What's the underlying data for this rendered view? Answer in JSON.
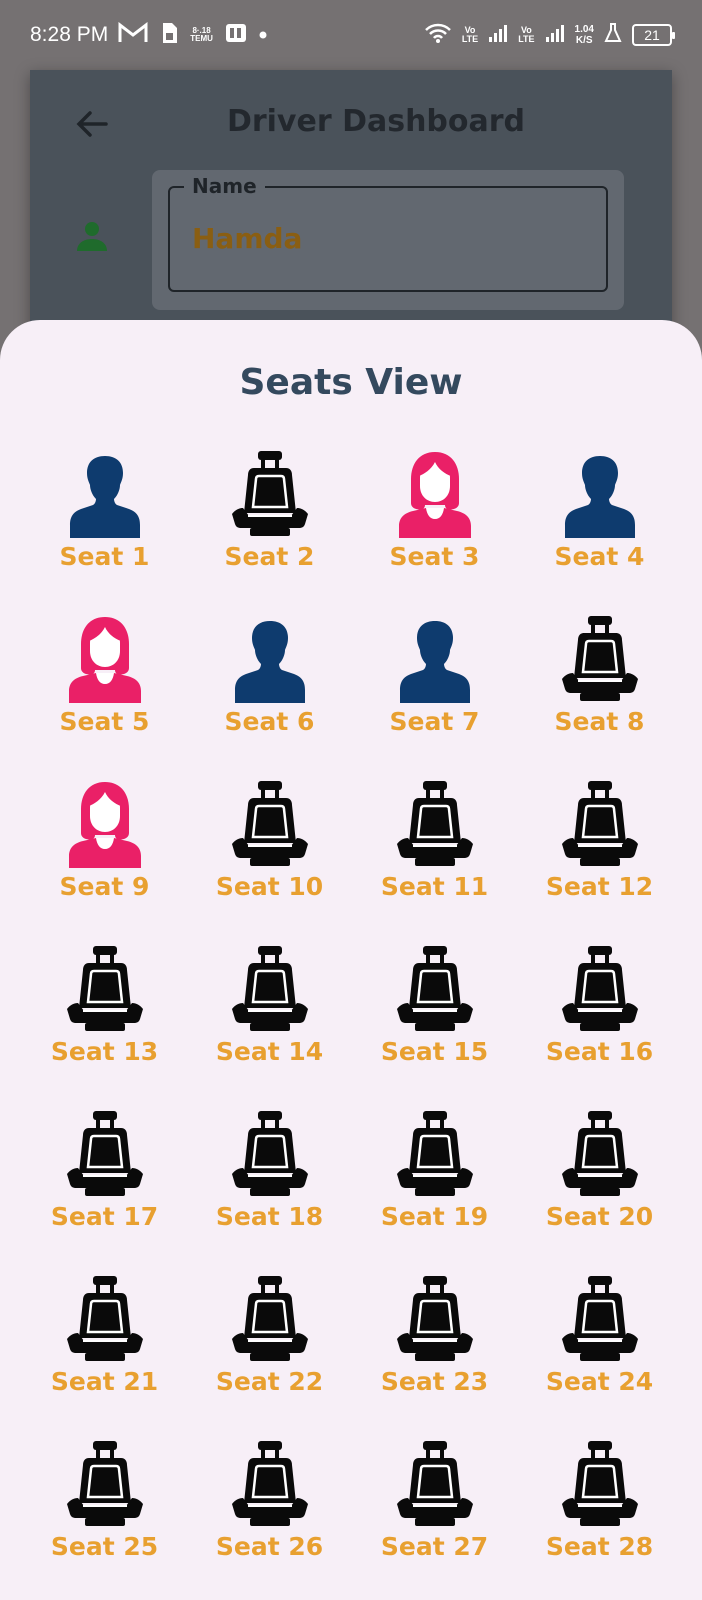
{
  "status_bar": {
    "time": "8:28 PM",
    "app_badge": "8·.18\nTEMU",
    "net1": "Vo\nLTE",
    "net2": "Vo\nLTE",
    "speed": "1.04\nK/S",
    "battery": "21"
  },
  "dashboard": {
    "title": "Driver Dashboard",
    "name_label": "Name",
    "name_value": "Hamda"
  },
  "sheet": {
    "title": "Seats View"
  },
  "colors": {
    "male": "#0e3b6e",
    "female": "#ea2067",
    "empty": "#0a0a0a",
    "label": "#e8a030"
  },
  "seats": [
    {
      "label": "Seat 1",
      "status": "male"
    },
    {
      "label": "Seat 2",
      "status": "empty"
    },
    {
      "label": "Seat 3",
      "status": "female"
    },
    {
      "label": "Seat 4",
      "status": "male"
    },
    {
      "label": "Seat 5",
      "status": "female"
    },
    {
      "label": "Seat 6",
      "status": "male"
    },
    {
      "label": "Seat 7",
      "status": "male"
    },
    {
      "label": "Seat 8",
      "status": "empty"
    },
    {
      "label": "Seat 9",
      "status": "female"
    },
    {
      "label": "Seat 10",
      "status": "empty"
    },
    {
      "label": "Seat 11",
      "status": "empty"
    },
    {
      "label": "Seat 12",
      "status": "empty"
    },
    {
      "label": "Seat 13",
      "status": "empty"
    },
    {
      "label": "Seat 14",
      "status": "empty"
    },
    {
      "label": "Seat 15",
      "status": "empty"
    },
    {
      "label": "Seat 16",
      "status": "empty"
    },
    {
      "label": "Seat 17",
      "status": "empty"
    },
    {
      "label": "Seat 18",
      "status": "empty"
    },
    {
      "label": "Seat 19",
      "status": "empty"
    },
    {
      "label": "Seat 20",
      "status": "empty"
    },
    {
      "label": "Seat 21",
      "status": "empty"
    },
    {
      "label": "Seat 22",
      "status": "empty"
    },
    {
      "label": "Seat 23",
      "status": "empty"
    },
    {
      "label": "Seat 24",
      "status": "empty"
    },
    {
      "label": "Seat 25",
      "status": "empty"
    },
    {
      "label": "Seat 26",
      "status": "empty"
    },
    {
      "label": "Seat 27",
      "status": "empty"
    },
    {
      "label": "Seat 28",
      "status": "empty"
    }
  ]
}
